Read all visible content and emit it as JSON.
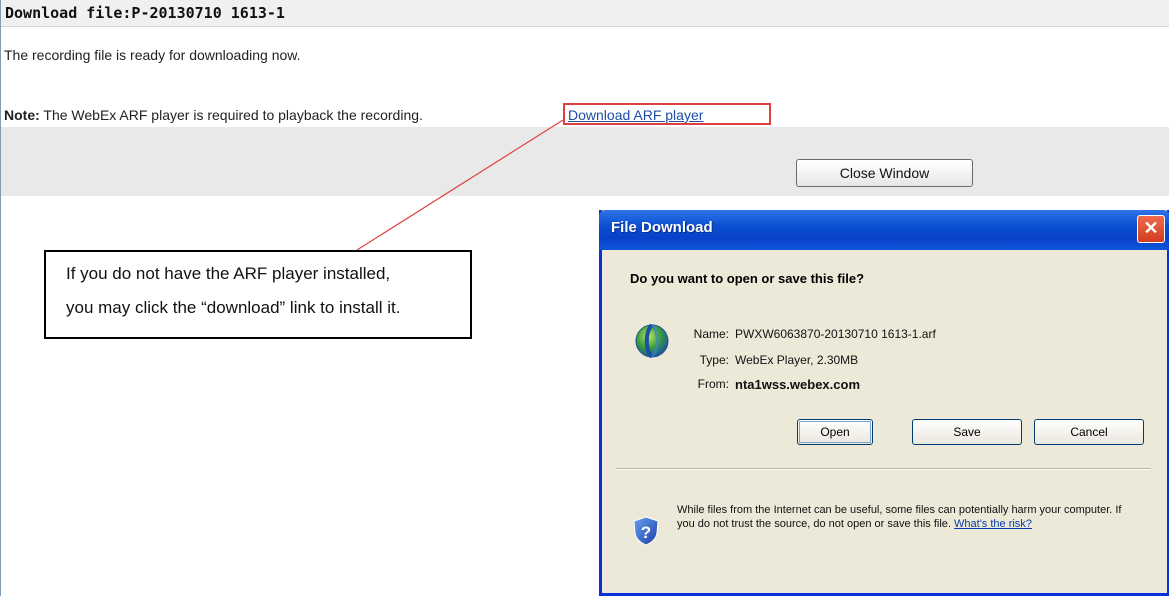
{
  "page": {
    "title": "Download file:P-20130710 1613-1",
    "ready_text": "The recording file is ready for downloading now.",
    "note_label": "Note:",
    "note_text": " The WebEx ARF player is required to playback the recording.",
    "arf_link": "Download ARF player",
    "close_button": "Close Window"
  },
  "callout": {
    "line1": "If you do not have the ARF player installed,",
    "line2": "you may click the “download” link to install it."
  },
  "dialog": {
    "title": "File Download",
    "close_glyph": "✕",
    "question": "Do you want to open or save this file?",
    "name_label": "Name:",
    "name_value": "PWXW6063870-20130710 1613-1.arf",
    "type_label": "Type:",
    "type_value": "WebEx Player, 2.30MB",
    "from_label": "From:",
    "from_value": "nta1wss.webex.com",
    "buttons": {
      "open": "Open",
      "save": "Save",
      "cancel": "Cancel"
    },
    "warning_text": "While files from the Internet can be useful, some files can potentially harm your computer. If you do not trust the source, do not open or save this file.",
    "risk_link": "What's the risk?",
    "file_icon": "globe-icon",
    "security_icon": "shield-question-icon"
  },
  "colors": {
    "highlight": "#e04040",
    "link": "#1f4ea8",
    "xp_title": "#0841c8"
  }
}
